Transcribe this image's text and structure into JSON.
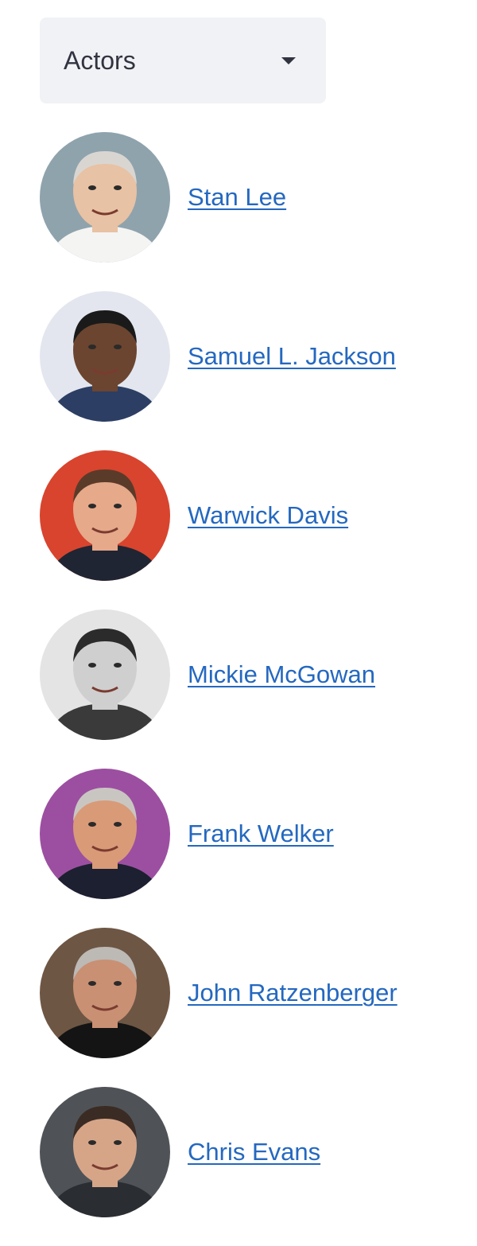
{
  "dropdown": {
    "label": "Actors",
    "icon": "caret-down-icon"
  },
  "colors": {
    "link": "#2468c0",
    "dropdown_bg": "#f0f2f6",
    "text": "#31333f"
  },
  "actors": [
    {
      "name": "Stan Lee",
      "avatar_bg": "#8fa3ad",
      "skin": "#e8c2a4",
      "hair": "#d9d6d2",
      "shirt": "#f4f4f2"
    },
    {
      "name": "Samuel L. Jackson",
      "avatar_bg": "#e3e6ee",
      "skin": "#6b4530",
      "hair": "#1a1a1a",
      "shirt": "#2c3e63"
    },
    {
      "name": "Warwick Davis",
      "avatar_bg": "#d8442e",
      "skin": "#e6a98a",
      "hair": "#5a3b2a",
      "shirt": "#1f2533"
    },
    {
      "name": "Mickie McGowan",
      "avatar_bg": "#e4e4e4",
      "skin": "#cfcfcf",
      "hair": "#2b2b2b",
      "shirt": "#3a3a3a"
    },
    {
      "name": "Frank Welker",
      "avatar_bg": "#9c4fa0",
      "skin": "#d99a78",
      "hair": "#c9c6c2",
      "shirt": "#1c2030"
    },
    {
      "name": "John Ratzenberger",
      "avatar_bg": "#6e5644",
      "skin": "#c99074",
      "hair": "#bdb9b5",
      "shirt": "#141414"
    },
    {
      "name": "Chris Evans",
      "avatar_bg": "#4f5357",
      "skin": "#d6a588",
      "hair": "#3a2c24",
      "shirt": "#2a2e33"
    }
  ]
}
